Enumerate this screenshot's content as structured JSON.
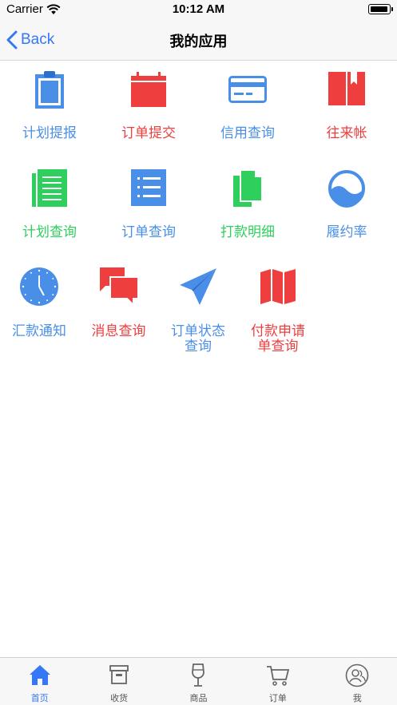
{
  "status_bar": {
    "carrier": "Carrier",
    "time": "10:12 AM"
  },
  "nav": {
    "back_label": "Back",
    "title": "我的应用"
  },
  "apps": {
    "plan_submit": {
      "label": "计划提报",
      "color": "#4a8fe7"
    },
    "order_submit": {
      "label": "订单提交",
      "color": "#ef3e3e"
    },
    "credit_query": {
      "label": "信用查询",
      "color": "#4a8fe7"
    },
    "accounts": {
      "label": "往来帐",
      "color": "#ef3e3e"
    },
    "plan_query": {
      "label": "计划查询",
      "color": "#2fcf5d"
    },
    "order_query": {
      "label": "订单查询",
      "color": "#4a8fe7"
    },
    "payment_detail": {
      "label": "打款明细",
      "color": "#2fcf5d"
    },
    "fulfillment_rate": {
      "label": "履约率",
      "color": "#4a8fe7"
    },
    "remit_notice": {
      "label": "汇款通知",
      "color": "#4a8fe7"
    },
    "message_query": {
      "label": "消息查询",
      "color": "#ef3e3e"
    },
    "order_status_line1": "订单状态",
    "order_status_line2": "查询",
    "order_status_color": "#4a8fe7",
    "payment_request_line1": "付款申请",
    "payment_request_line2": "单查询",
    "payment_request_color": "#ef3e3e"
  },
  "icons": {
    "plan_submit": "clipboard-icon",
    "order_submit": "calendar-icon",
    "credit_query": "credit-card-icon",
    "accounts": "book-icon",
    "plan_query": "document-lines-icon",
    "order_query": "list-icon",
    "payment_detail": "copy-icon",
    "fulfillment_rate": "wave-circle-icon",
    "remit_notice": "clock-icon",
    "message_query": "chat-bubbles-icon",
    "order_status": "paper-plane-icon",
    "payment_request": "map-icon"
  },
  "tabs": [
    {
      "label": "首页",
      "icon": "home-icon",
      "active": true
    },
    {
      "label": "收货",
      "icon": "box-icon",
      "active": false
    },
    {
      "label": "商品",
      "icon": "wine-glass-icon",
      "active": false
    },
    {
      "label": "订单",
      "icon": "cart-icon",
      "active": false
    },
    {
      "label": "我",
      "icon": "user-icon",
      "active": false
    }
  ],
  "colors": {
    "accent": "#3478f6",
    "blue": "#4a8fe7",
    "red": "#ef3e3e",
    "green": "#2fcf5d"
  }
}
